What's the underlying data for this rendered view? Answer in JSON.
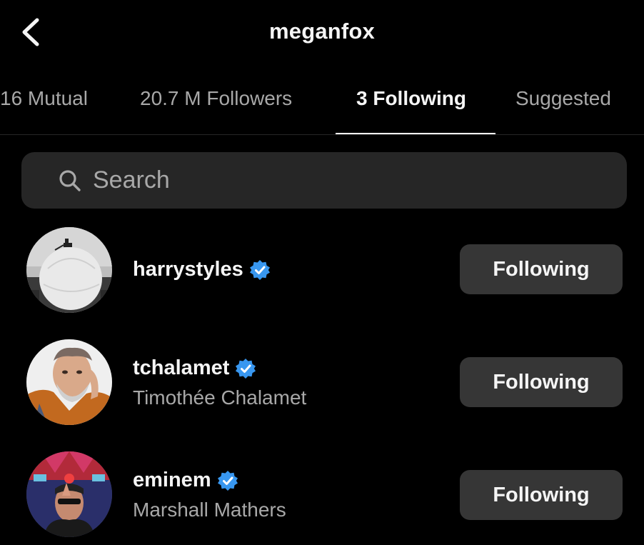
{
  "header": {
    "title": "meganfox",
    "back_icon": "chevron-left-icon"
  },
  "tabs": [
    {
      "label": "16 Mutual",
      "active": false
    },
    {
      "label": "20.7 M Followers",
      "active": false
    },
    {
      "label": "3 Following",
      "active": true
    },
    {
      "label": "Suggested",
      "active": false
    }
  ],
  "search": {
    "placeholder": "Search",
    "value": ""
  },
  "accounts": [
    {
      "username": "harrystyles",
      "full_name": "",
      "verified": true,
      "button_label": "Following"
    },
    {
      "username": "tchalamet",
      "full_name": "Timothée Chalamet",
      "verified": true,
      "button_label": "Following"
    },
    {
      "username": "eminem",
      "full_name": "Marshall Mathers",
      "verified": true,
      "button_label": "Following"
    }
  ],
  "colors": {
    "background": "#000000",
    "surface": "#262626",
    "button": "#363636",
    "verified": "#3897f0",
    "muted_text": "#a8a8a8"
  }
}
